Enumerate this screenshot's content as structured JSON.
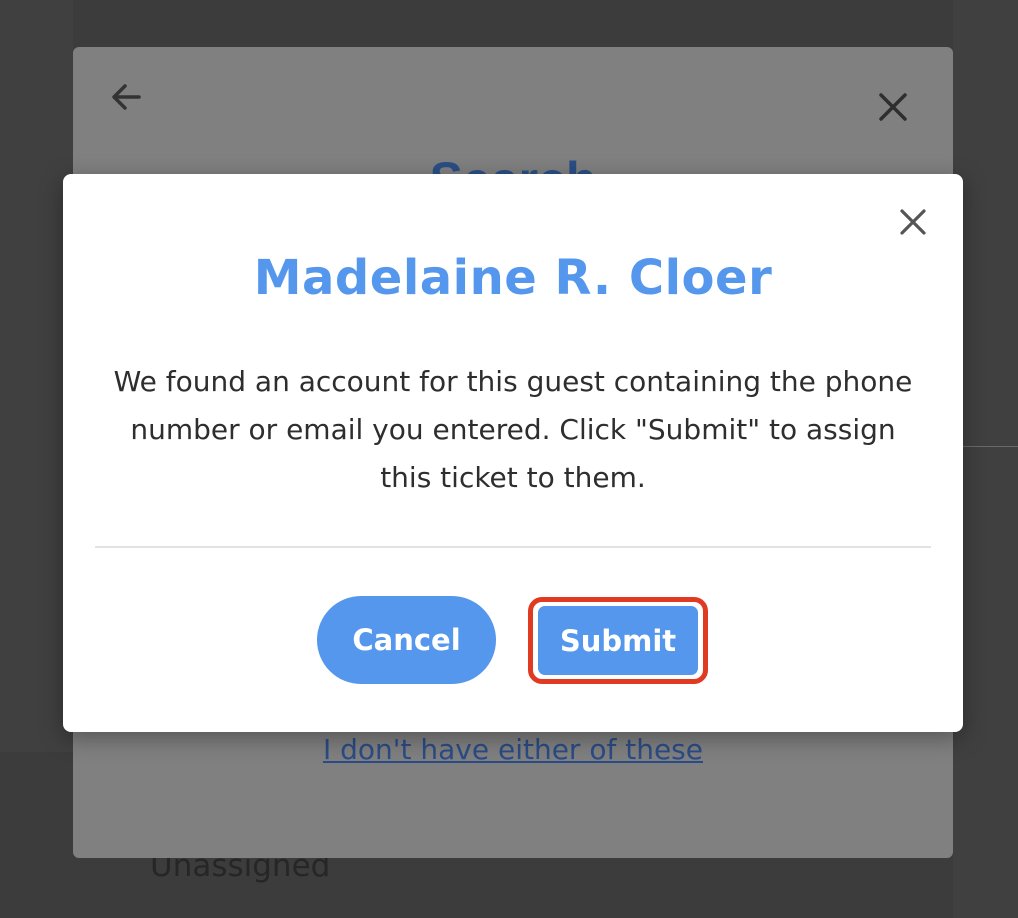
{
  "background": {
    "unassigned_text": "Unassigned",
    "dialog": {
      "title_peek": "Search",
      "alt_link": "I don't have either of these",
      "back_icon": "arrow-left-icon",
      "close_icon": "close-icon"
    }
  },
  "modal": {
    "title": "Madelaine R. Cloer",
    "message": "We found an account for this guest containing the phone number or email you entered. Click \"Submit\" to assign this ticket to them.",
    "close_icon": "close-icon",
    "cancel_label": "Cancel",
    "submit_label": "Submit"
  },
  "colors": {
    "accent": "#5497ed",
    "highlight": "#e03a22",
    "overlay": "#3c3c3c"
  }
}
